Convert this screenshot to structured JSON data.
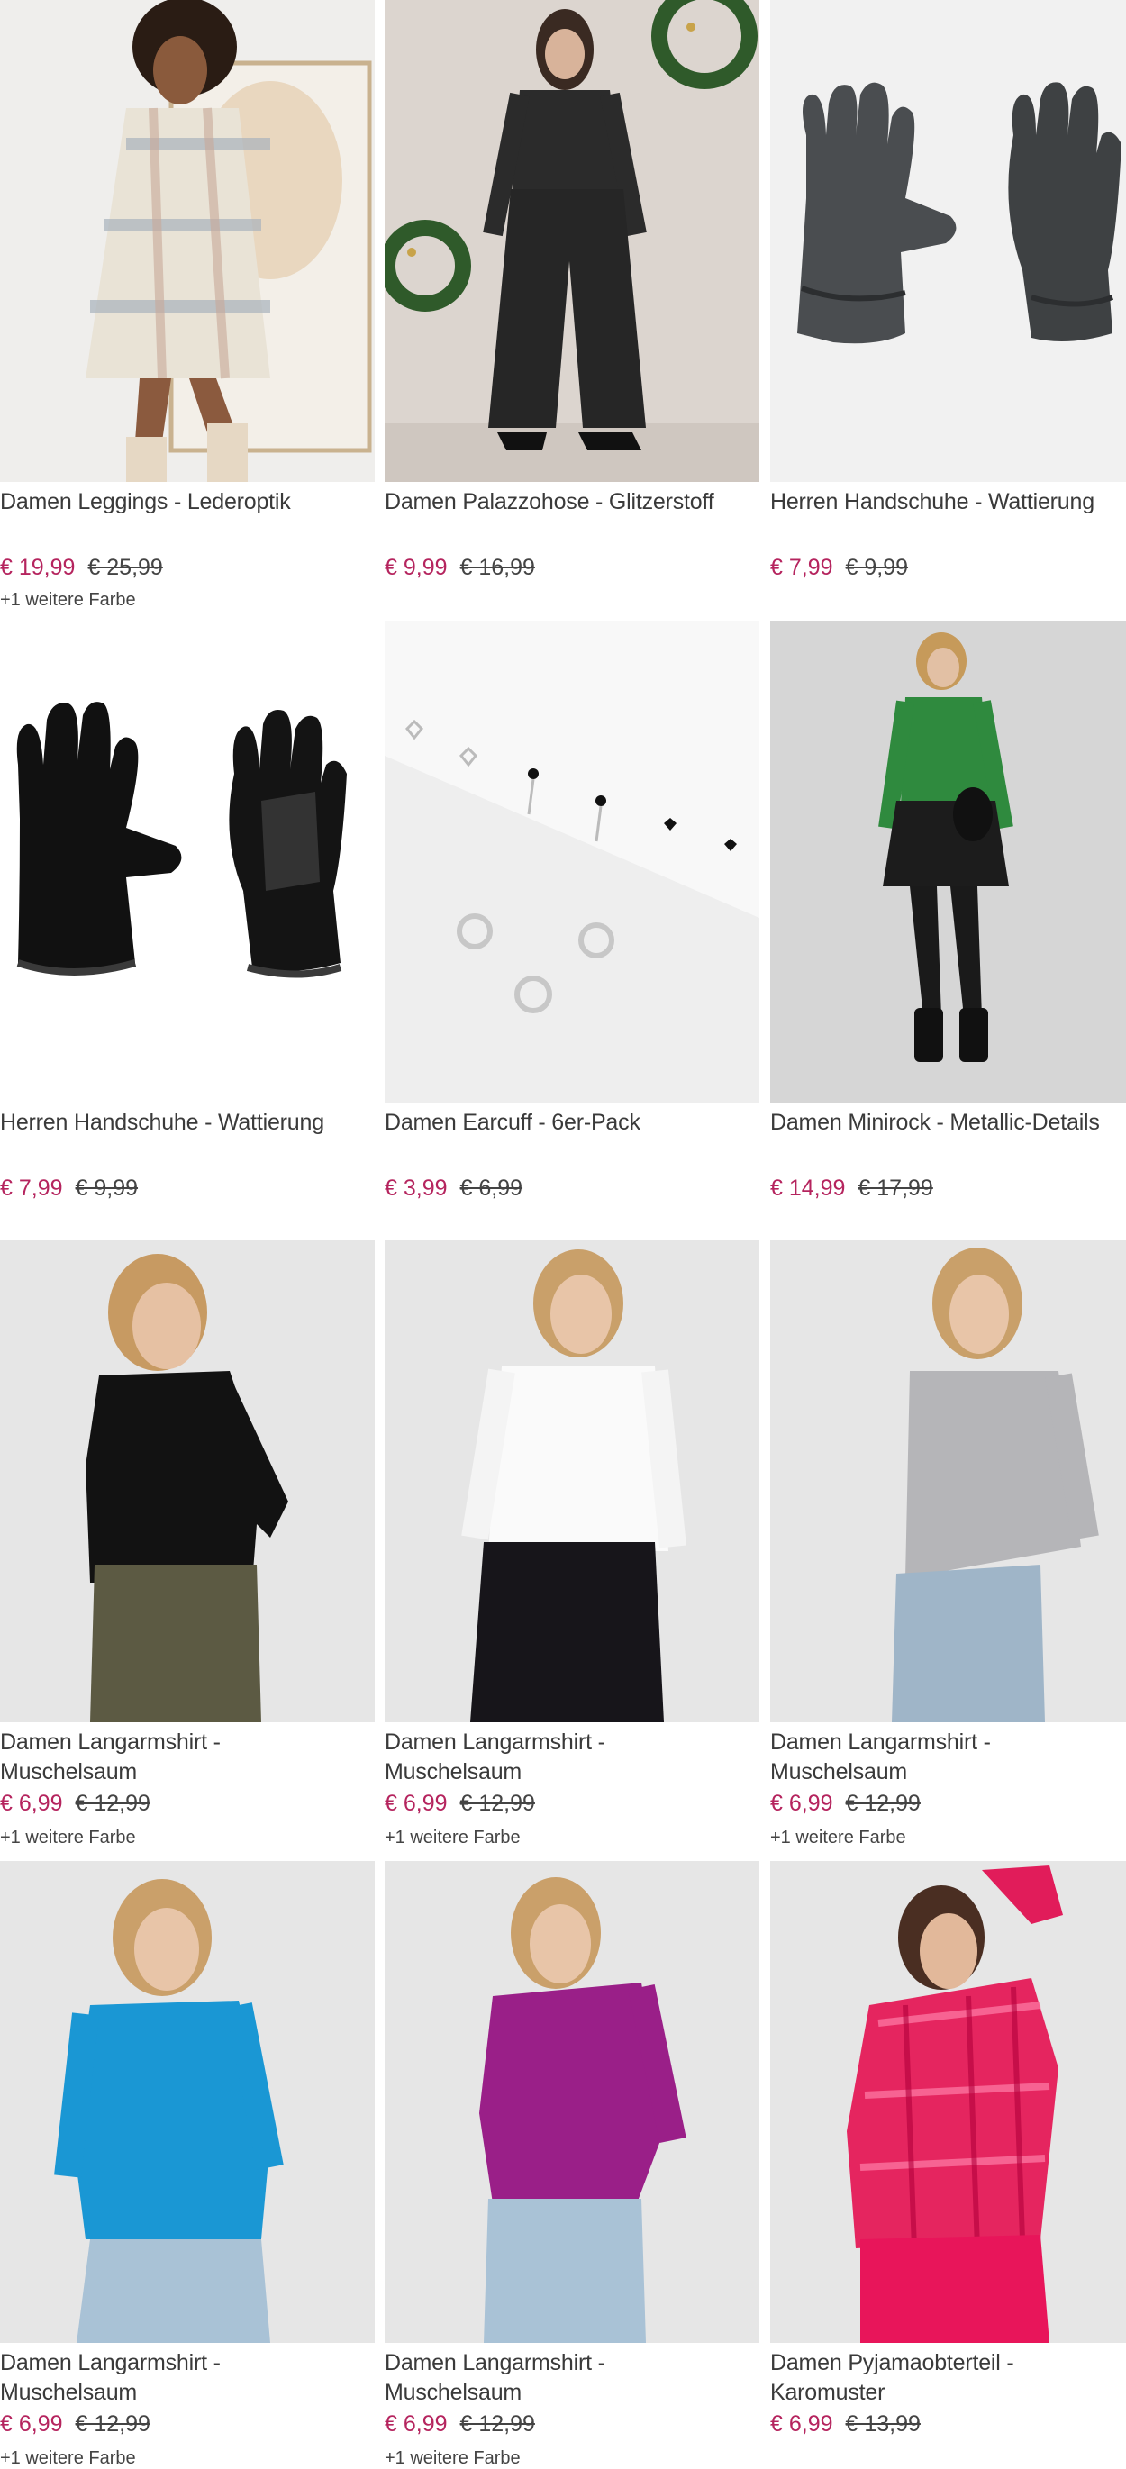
{
  "colors": {
    "price": "#b5245e",
    "text": "#3a3a3a",
    "strike": "#444444"
  },
  "products": [
    {
      "name": "Damen Leggings - Lederoptik",
      "price": "€ 19,99",
      "old_price": "€ 25,99",
      "more": "+1 weitere Farbe",
      "image": "woman-in-checked-coat"
    },
    {
      "name": "Damen Palazzohose - Glitzerstoff",
      "price": "€ 9,99",
      "old_price": "€ 16,99",
      "more": "",
      "image": "woman-in-black-glitter-suit"
    },
    {
      "name": "Herren Handschuhe - Wattierung",
      "price": "€ 7,99",
      "old_price": "€ 9,99",
      "more": "",
      "image": "grey-gloves"
    },
    {
      "name": "Herren Handschuhe - Wattierung",
      "price": "€ 7,99",
      "old_price": "€ 9,99",
      "more": "",
      "image": "black-gloves"
    },
    {
      "name": "Damen Earcuff - 6er-Pack",
      "price": "€ 3,99",
      "old_price": "€ 6,99",
      "more": "",
      "image": "earcuffs"
    },
    {
      "name": "Damen Minirock - Metallic-Details",
      "price": "€ 14,99",
      "old_price": "€ 17,99",
      "more": "",
      "image": "woman-green-top-black-skirt"
    },
    {
      "name": "Damen Langarmshirt -\nMuschelsaum",
      "price": "€ 6,99",
      "old_price": "€ 12,99",
      "more": "+1 weitere Farbe",
      "image": "woman-black-shirt"
    },
    {
      "name": "Damen Langarmshirt -\nMuschelsaum",
      "price": "€ 6,99",
      "old_price": "€ 12,99",
      "more": "+1 weitere Farbe",
      "image": "woman-white-shirt"
    },
    {
      "name": "Damen Langarmshirt -\nMuschelsaum",
      "price": "€ 6,99",
      "old_price": "€ 12,99",
      "more": "+1 weitere Farbe",
      "image": "woman-grey-shirt"
    },
    {
      "name": "Damen Langarmshirt -\nMuschelsaum",
      "price": "€ 6,99",
      "old_price": "€ 12,99",
      "more": "+1 weitere Farbe",
      "image": "woman-blue-shirt"
    },
    {
      "name": "Damen Langarmshirt -\nMuschelsaum",
      "price": "€ 6,99",
      "old_price": "€ 12,99",
      "more": "+1 weitere Farbe",
      "image": "woman-purple-shirt"
    },
    {
      "name": "Damen Pyjamaobterteil -\nKaromuster",
      "price": "€ 6,99",
      "old_price": "€ 13,99",
      "more": "",
      "image": "woman-pink-checked-pyjama"
    }
  ]
}
